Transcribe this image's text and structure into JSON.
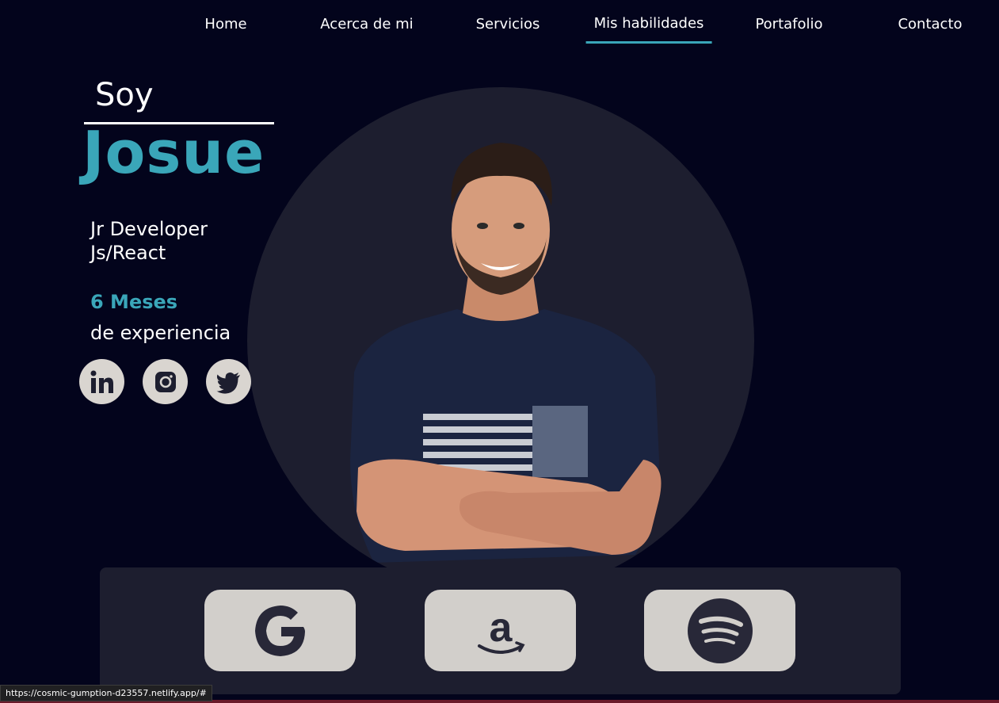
{
  "nav": {
    "items": [
      {
        "label": "Home",
        "active": false
      },
      {
        "label": "Acerca de mi",
        "active": false
      },
      {
        "label": "Servicios",
        "active": false
      },
      {
        "label": "Mis habilidades",
        "active": true
      },
      {
        "label": "Portafolio",
        "active": false
      },
      {
        "label": "Contacto",
        "active": false
      }
    ]
  },
  "hero": {
    "intro": "Soy",
    "name": "Josue",
    "role_line1": "Jr Developer",
    "role_line2": "Js/React",
    "experience_value": "6 Meses",
    "experience_text": "de experiencia"
  },
  "social": [
    {
      "icon": "linkedin-icon"
    },
    {
      "icon": "instagram-icon"
    },
    {
      "icon": "twitter-icon"
    }
  ],
  "brands": [
    {
      "icon": "google-icon"
    },
    {
      "icon": "amazon-icon"
    },
    {
      "icon": "spotify-icon"
    }
  ],
  "status_bar": {
    "url": "https://cosmic-gumption-d23557.netlify.app/#"
  },
  "colors": {
    "background": "#03041c",
    "accent": "#3aa6b9",
    "panel": "#1d1e2f",
    "card": "#d2cfcb"
  }
}
